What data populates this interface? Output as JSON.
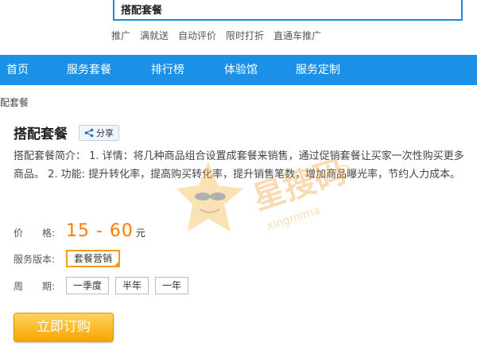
{
  "search": {
    "value": "搭配套餐"
  },
  "hot_links": [
    "推广",
    "满就送",
    "自动评价",
    "限时打折",
    "直通车推广"
  ],
  "nav": {
    "items": [
      "首页",
      "服务套餐",
      "排行榜",
      "体验馆",
      "服务定制"
    ],
    "color": "#1a90e6"
  },
  "breadcrumb": "配套餐",
  "product": {
    "title": "搭配套餐",
    "share_label": "分享",
    "description": "搭配套餐简介： 1. 详情：将几种商品组合设置成套餐来销售，通过促销套餐让买家一次性购买更多商品。 2. 功能: 提升转化率，提高购买转化率，提升销售笔数，增加商品曝光率，节约人力成本。"
  },
  "price": {
    "label": "价　　格:",
    "value": "15 - 60",
    "unit": "元",
    "color": "#ff7c00"
  },
  "version": {
    "label": "服务版本:",
    "options": [
      "套餐营销"
    ]
  },
  "period": {
    "label": "周　　期:",
    "options": [
      "一季度",
      "半年",
      "一年"
    ]
  },
  "buy_label": "立即订购",
  "watermark": {
    "text": "星搜码",
    "sub": "xingmima"
  }
}
